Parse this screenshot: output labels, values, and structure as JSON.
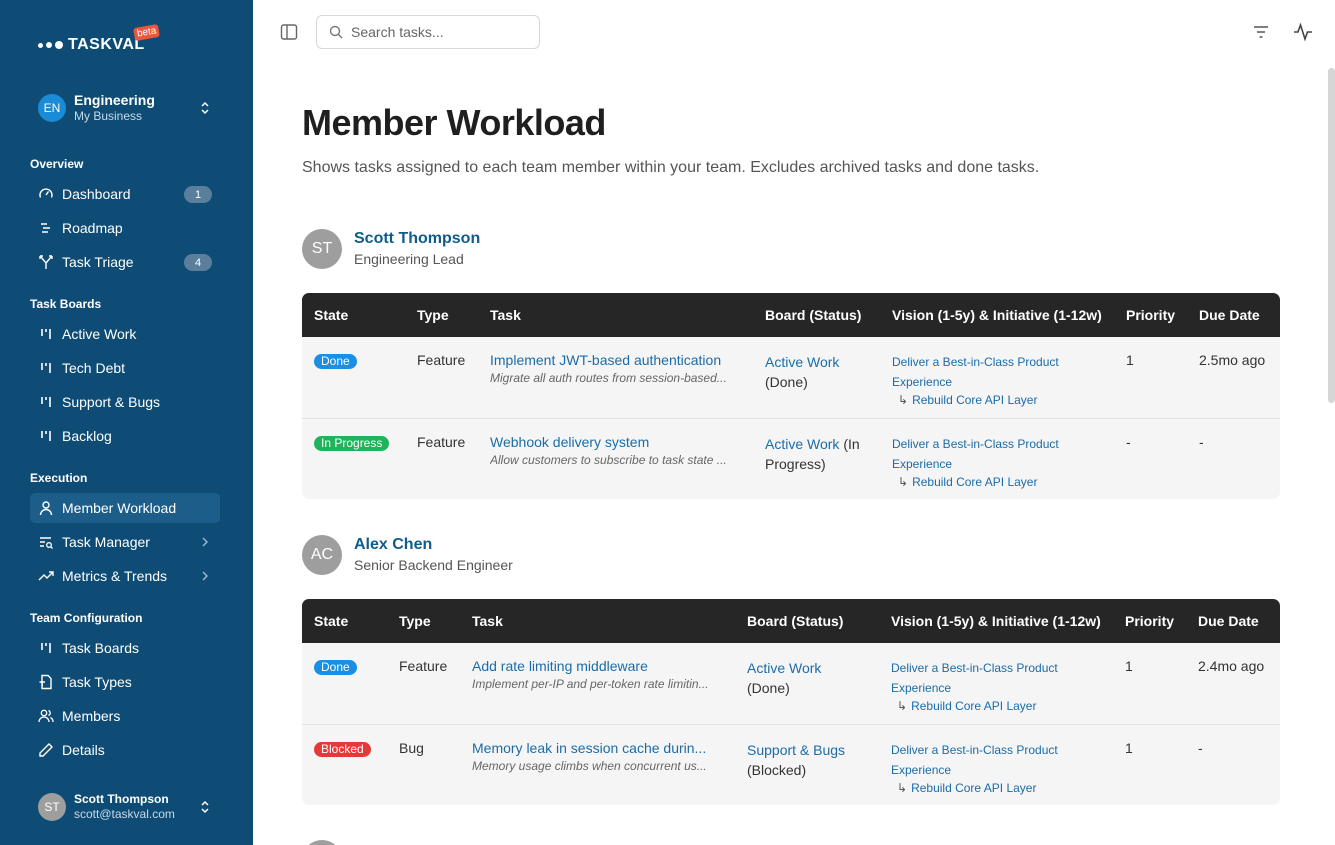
{
  "app": {
    "logo_text": "TASKVAL",
    "beta_label": "beta"
  },
  "team": {
    "initials": "EN",
    "name": "Engineering",
    "subtitle": "My Business"
  },
  "nav": {
    "overview_label": "Overview",
    "dashboard": {
      "label": "Dashboard",
      "badge": "1"
    },
    "roadmap": {
      "label": "Roadmap"
    },
    "task_triage": {
      "label": "Task Triage",
      "badge": "4"
    },
    "boards_label": "Task Boards",
    "active_work": {
      "label": "Active Work"
    },
    "tech_debt": {
      "label": "Tech Debt"
    },
    "support_bugs": {
      "label": "Support & Bugs"
    },
    "backlog": {
      "label": "Backlog"
    },
    "execution_label": "Execution",
    "member_workload": {
      "label": "Member Workload"
    },
    "task_manager": {
      "label": "Task Manager"
    },
    "metrics_trends": {
      "label": "Metrics & Trends"
    },
    "config_label": "Team Configuration",
    "task_boards": {
      "label": "Task Boards"
    },
    "task_types": {
      "label": "Task Types"
    },
    "members": {
      "label": "Members"
    },
    "details": {
      "label": "Details"
    }
  },
  "current_user": {
    "initials": "ST",
    "name": "Scott Thompson",
    "email": "scott@taskval.com"
  },
  "search": {
    "placeholder": "Search tasks..."
  },
  "page": {
    "title": "Member Workload",
    "description": "Shows tasks assigned to each team member within your team. Excludes archived tasks and done tasks."
  },
  "columns": {
    "state": "State",
    "type": "Type",
    "task": "Task",
    "board": "Board (Status)",
    "vision": "Vision (1-5y) & Initiative (1-12w)",
    "priority": "Priority",
    "due": "Due Date"
  },
  "colors": {
    "done": "#1a8fe3",
    "in_progress": "#1fb35b",
    "blocked": "#e53935"
  },
  "members": [
    {
      "initials": "ST",
      "name": "Scott Thompson",
      "role": "Engineering Lead",
      "tasks": [
        {
          "state": "Done",
          "type": "Feature",
          "title": "Implement JWT-based authentication",
          "subtitle": "Migrate all auth routes from session-based...",
          "board": "Active Work",
          "board_status": "(Done)",
          "vision": "Deliver a Best-in-Class Product Experience",
          "initiative": "Rebuild Core API Layer",
          "priority": "1",
          "due": "2.5mo ago"
        },
        {
          "state": "In Progress",
          "type": "Feature",
          "title": "Webhook delivery system",
          "subtitle": "Allow customers to subscribe to task state ...",
          "board": "Active Work",
          "board_status": "(In Progress)",
          "vision": "Deliver a Best-in-Class Product Experience",
          "initiative": "Rebuild Core API Layer",
          "priority": "-",
          "due": "-"
        }
      ]
    },
    {
      "initials": "AC",
      "name": "Alex Chen",
      "role": "Senior Backend Engineer",
      "tasks": [
        {
          "state": "Done",
          "type": "Feature",
          "title": "Add rate limiting middleware",
          "subtitle": "Implement per-IP and per-token rate limitin...",
          "board": "Active Work",
          "board_status": "(Done)",
          "vision": "Deliver a Best-in-Class Product Experience",
          "initiative": "Rebuild Core API Layer",
          "priority": "1",
          "due": "2.4mo ago"
        },
        {
          "state": "Blocked",
          "type": "Bug",
          "title": "Memory leak in session cache durin...",
          "subtitle": "Memory usage climbs when concurrent us...",
          "board": "Support & Bugs",
          "board_status": "(Blocked)",
          "vision": "Deliver a Best-in-Class Product Experience",
          "initiative": "Rebuild Core API Layer",
          "priority": "1",
          "due": "-"
        }
      ]
    }
  ]
}
